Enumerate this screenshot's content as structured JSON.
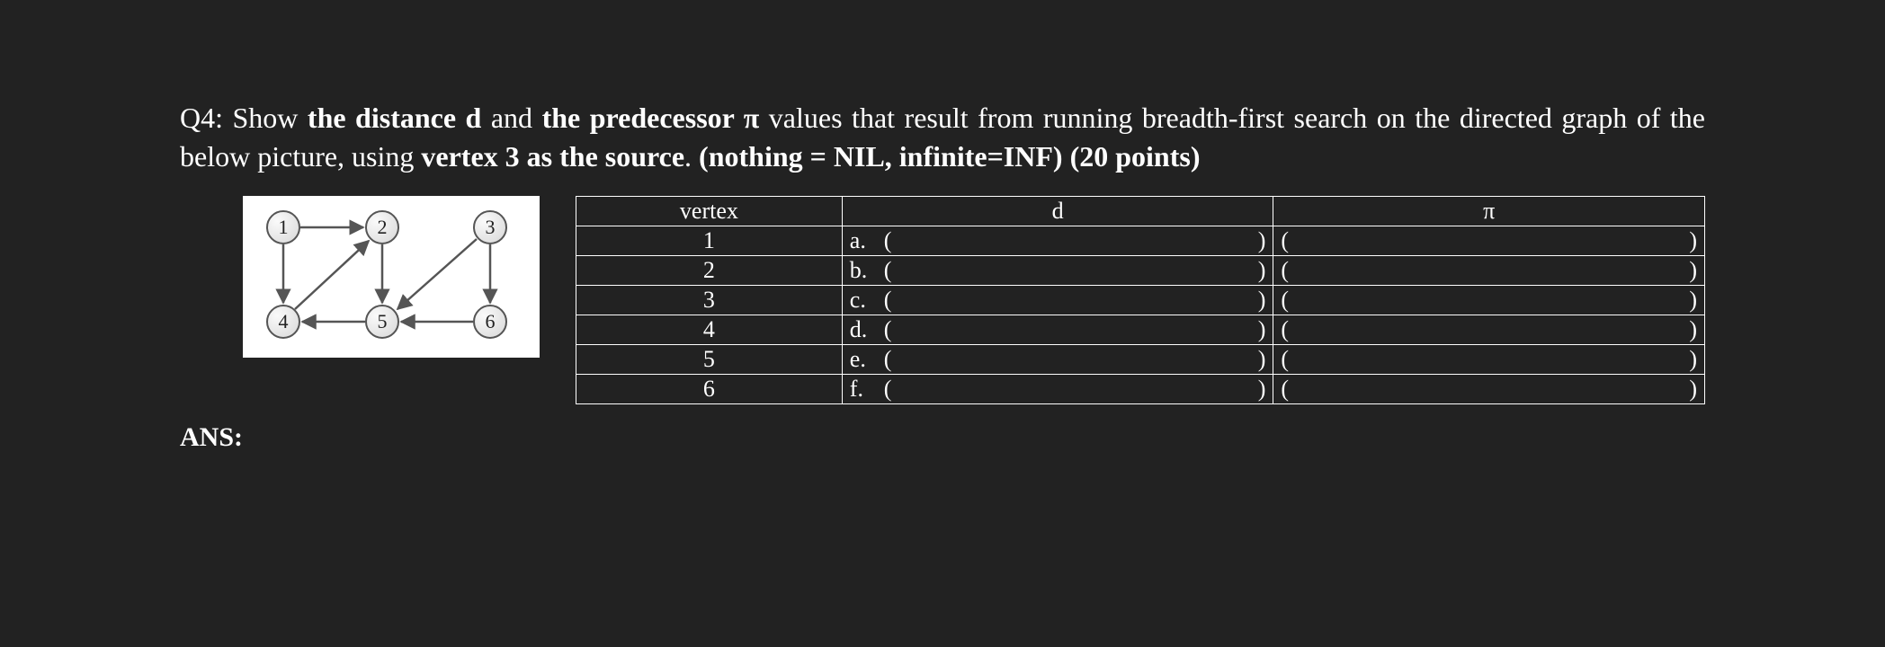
{
  "question": {
    "prefix": "Q4: Show ",
    "b1": "the distance d",
    "mid1": " and ",
    "b2": "the predecessor π",
    "mid2": " values that result from running breadth-first search on the directed graph of the below picture, using ",
    "b3": "vertex 3 as the source",
    "mid3": ". ",
    "b4": "(nothing = NIL, infinite=INF) (20 points)"
  },
  "graph": {
    "nodes": [
      "1",
      "2",
      "3",
      "4",
      "5",
      "6"
    ]
  },
  "table": {
    "headers": {
      "vertex": "vertex",
      "d": "d",
      "pi": "π"
    },
    "rows": [
      {
        "vertex": "1",
        "label": "a."
      },
      {
        "vertex": "2",
        "label": "b."
      },
      {
        "vertex": "3",
        "label": "c."
      },
      {
        "vertex": "4",
        "label": "d."
      },
      {
        "vertex": "5",
        "label": "e."
      },
      {
        "vertex": "6",
        "label": "f."
      }
    ]
  },
  "answer_label": "ANS:"
}
